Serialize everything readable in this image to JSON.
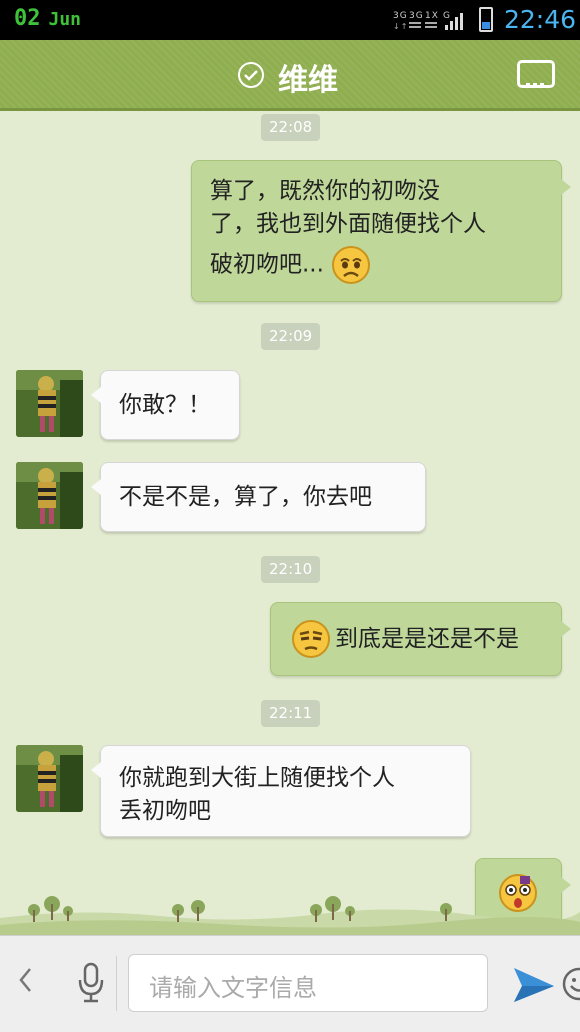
{
  "status_bar": {
    "day": "02",
    "month": "Jun",
    "signal_text": "3G 3G 1X G",
    "time": "22:46",
    "battery_level": 0.35
  },
  "header": {
    "title": "维维",
    "menu_icon": "chat-menu-icon"
  },
  "messages": {
    "t1": "22:08",
    "m1_line1": "算了，既然你的初吻没",
    "m1_line2": "了，我也到外面随便找个人",
    "m1_line3": "破初吻吧...",
    "t2": "22:09",
    "m2": "你敢？！",
    "m3": "不是不是，算了，你去吧",
    "t3": "22:10",
    "m4": "到底是是还是不是",
    "t4": "22:11",
    "m5_line1": "你就跑到大街上随便找个人",
    "m5_line2": "丢初吻吧"
  },
  "input": {
    "placeholder": "请输入文字信息"
  },
  "colors": {
    "accent": "#8fae4f",
    "sent_bubble": "#bfd89a",
    "background": "#e3ecd0"
  }
}
